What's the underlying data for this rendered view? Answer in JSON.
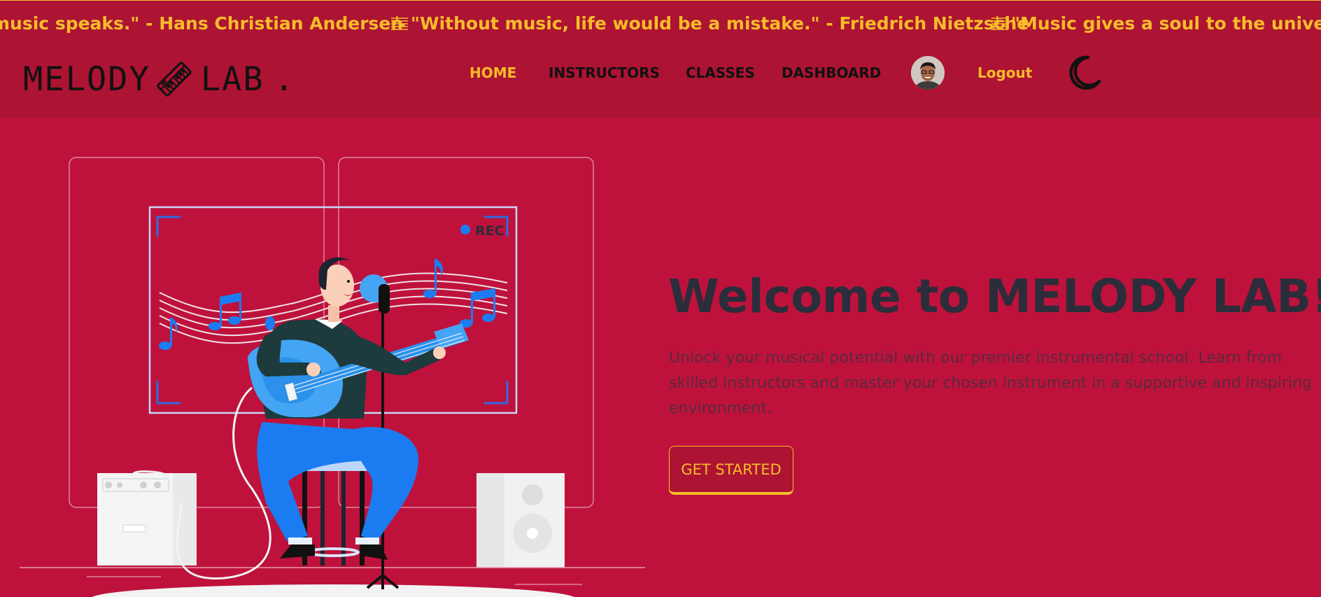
{
  "marquee": {
    "quotes": [
      "music speaks.\" - Hans Christian Andersen",
      "\"Without music, life would be a mistake.\" - Friedrich Nietzsche",
      "\"Music gives a soul to the universe"
    ]
  },
  "navbar": {
    "logo_left": "MELODY",
    "logo_right": "LAB",
    "logo_dot": ".",
    "links": [
      "HOME",
      "INSTRUCTORS",
      "CLASSES",
      "DASHBOARD"
    ],
    "logout": "Logout"
  },
  "hero": {
    "title": "Welcome to MELODY LAB!",
    "description": "Unlock your musical potential with our premier instrumental school. Learn from skilled instructors and master your chosen instrument in a supportive and inspiring environment.",
    "cta": "GET STARTED",
    "rec_label": "REC"
  },
  "colors": {
    "background": "#be123c",
    "navbar": "#ad1333",
    "accent": "#f6bd29",
    "title": "#2b2d3a",
    "illustration_blue": "#1b7cf2"
  },
  "icons": {
    "logo": "keyboard-icon",
    "quote_prefix": "music-staff-icon",
    "theme_toggle": "moon-icon"
  }
}
